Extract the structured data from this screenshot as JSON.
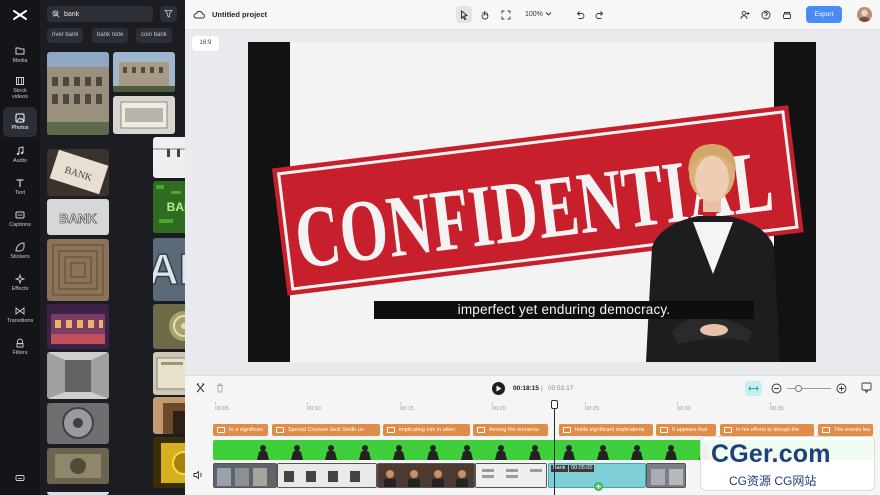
{
  "app": {
    "title": "Untitled project",
    "zoom": "100%",
    "export_label": "Export"
  },
  "rail": {
    "items": [
      {
        "label": "Media",
        "icon": "folder-icon"
      },
      {
        "label": "Stock videos",
        "icon": "film-icon"
      },
      {
        "label": "Photos",
        "icon": "image-icon"
      },
      {
        "label": "Audio",
        "icon": "music-icon"
      },
      {
        "label": "Text",
        "icon": "text-icon"
      },
      {
        "label": "Captions",
        "icon": "captions-icon"
      },
      {
        "label": "Stickers",
        "icon": "sticker-icon"
      },
      {
        "label": "Effects",
        "icon": "sparkle-icon"
      },
      {
        "label": "Transitions",
        "icon": "transition-icon"
      },
      {
        "label": "Filters",
        "icon": "filter-icon"
      }
    ],
    "active_index": 2
  },
  "panel": {
    "search": {
      "value": "bank",
      "placeholder": "Search"
    },
    "chips": [
      "river bank",
      "bank note",
      "coin bank"
    ]
  },
  "canvas": {
    "ratio": "16:9",
    "caption": "imperfect yet enduring democracy.",
    "stamp_text": "CONFIDENTIAL"
  },
  "timeline": {
    "current_time": "00:18:15",
    "separator": "|",
    "total_time": "00:53:17",
    "ruler": [
      "00:05",
      "00:10",
      "00:15",
      "00:20",
      "00:25",
      "00:30",
      "00:35"
    ],
    "subtitles": [
      "In a significan",
      "Special Counsel Jack Smith un",
      "implicating him in atten",
      "Among the numerou",
      "holds significant implications",
      "It appears that",
      "In his efforts to disrupt the",
      "The events lea"
    ],
    "selected_clip": {
      "name": "Bank",
      "duration": "00:05:00"
    }
  },
  "watermark": {
    "main": "CGer.com",
    "sub": "CG资源 CG网站"
  },
  "colors": {
    "accent": "#4a8cf7",
    "subtitle_track": "#e08d4a",
    "audio_track": "#3fcf3a",
    "selected_clip": "#7fd0d6"
  }
}
